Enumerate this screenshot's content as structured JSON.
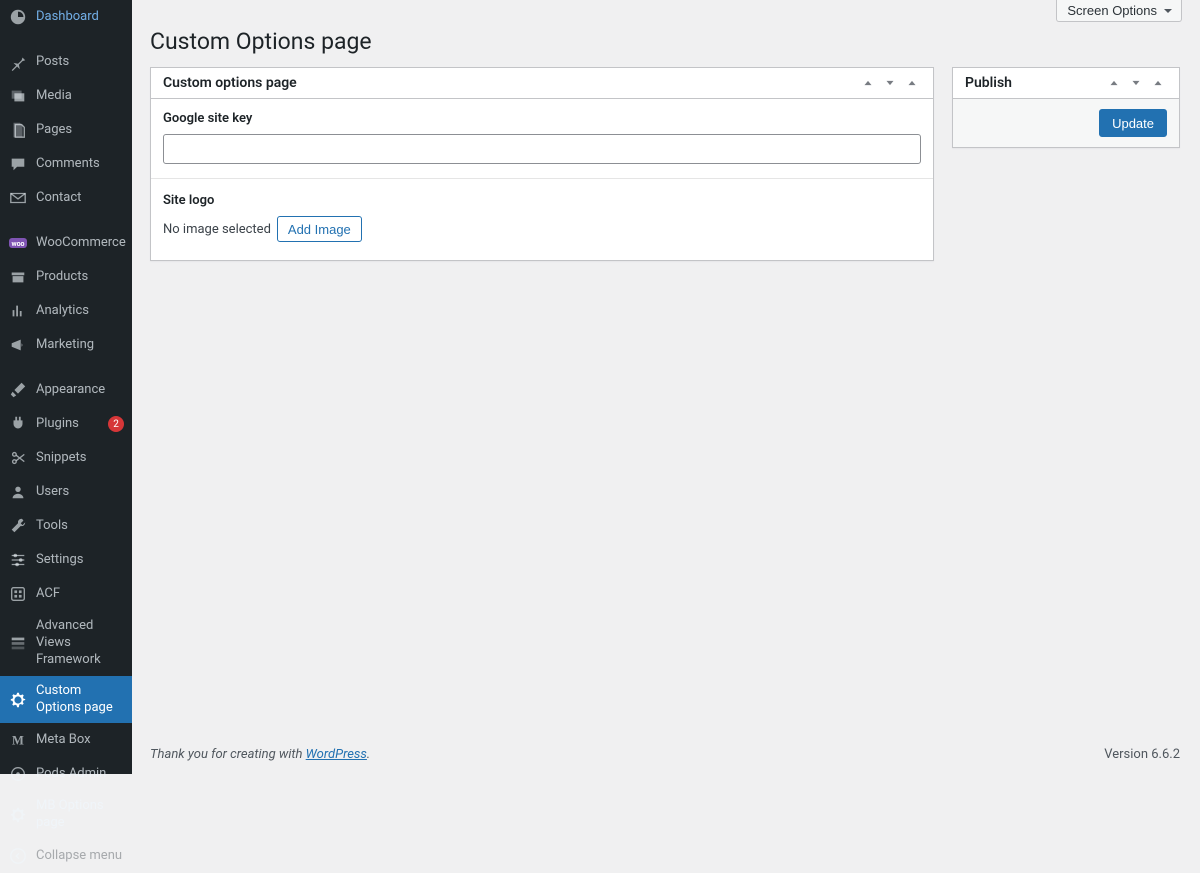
{
  "sidebar": {
    "items": [
      {
        "label": "Dashboard",
        "icon": "dashboard"
      },
      {
        "label": "Posts",
        "icon": "pin"
      },
      {
        "label": "Media",
        "icon": "media"
      },
      {
        "label": "Pages",
        "icon": "pages"
      },
      {
        "label": "Comments",
        "icon": "comment"
      },
      {
        "label": "Contact",
        "icon": "envelope"
      },
      {
        "label": "WooCommerce",
        "icon": "woo"
      },
      {
        "label": "Products",
        "icon": "archive"
      },
      {
        "label": "Analytics",
        "icon": "chart"
      },
      {
        "label": "Marketing",
        "icon": "megaphone"
      },
      {
        "label": "Appearance",
        "icon": "brush"
      },
      {
        "label": "Plugins",
        "icon": "plug",
        "badge": "2"
      },
      {
        "label": "Snippets",
        "icon": "scissors"
      },
      {
        "label": "Users",
        "icon": "user"
      },
      {
        "label": "Tools",
        "icon": "wrench"
      },
      {
        "label": "Settings",
        "icon": "sliders"
      },
      {
        "label": "ACF",
        "icon": "acf"
      },
      {
        "label": "Advanced Views Framework",
        "icon": "avf"
      },
      {
        "label": "Custom Options page",
        "icon": "gear",
        "current": true
      },
      {
        "label": "Meta Box",
        "icon": "metabox"
      },
      {
        "label": "Pods Admin",
        "icon": "pods"
      },
      {
        "label": "MB Options page",
        "icon": "gear2"
      }
    ],
    "collapse_label": "Collapse menu"
  },
  "screen_options_label": "Screen Options",
  "page_title": "Custom Options page",
  "metabox": {
    "title": "Custom options page",
    "field_google_label": "Google site key",
    "field_google_value": "",
    "field_logo_label": "Site logo",
    "no_image_text": "No image selected",
    "add_image_label": "Add Image"
  },
  "publish": {
    "title": "Publish",
    "button": "Update"
  },
  "footer": {
    "thank_you_prefix": "Thank you for creating with ",
    "wp_link_text": "WordPress",
    "version_label": "Version 6.6.2"
  }
}
